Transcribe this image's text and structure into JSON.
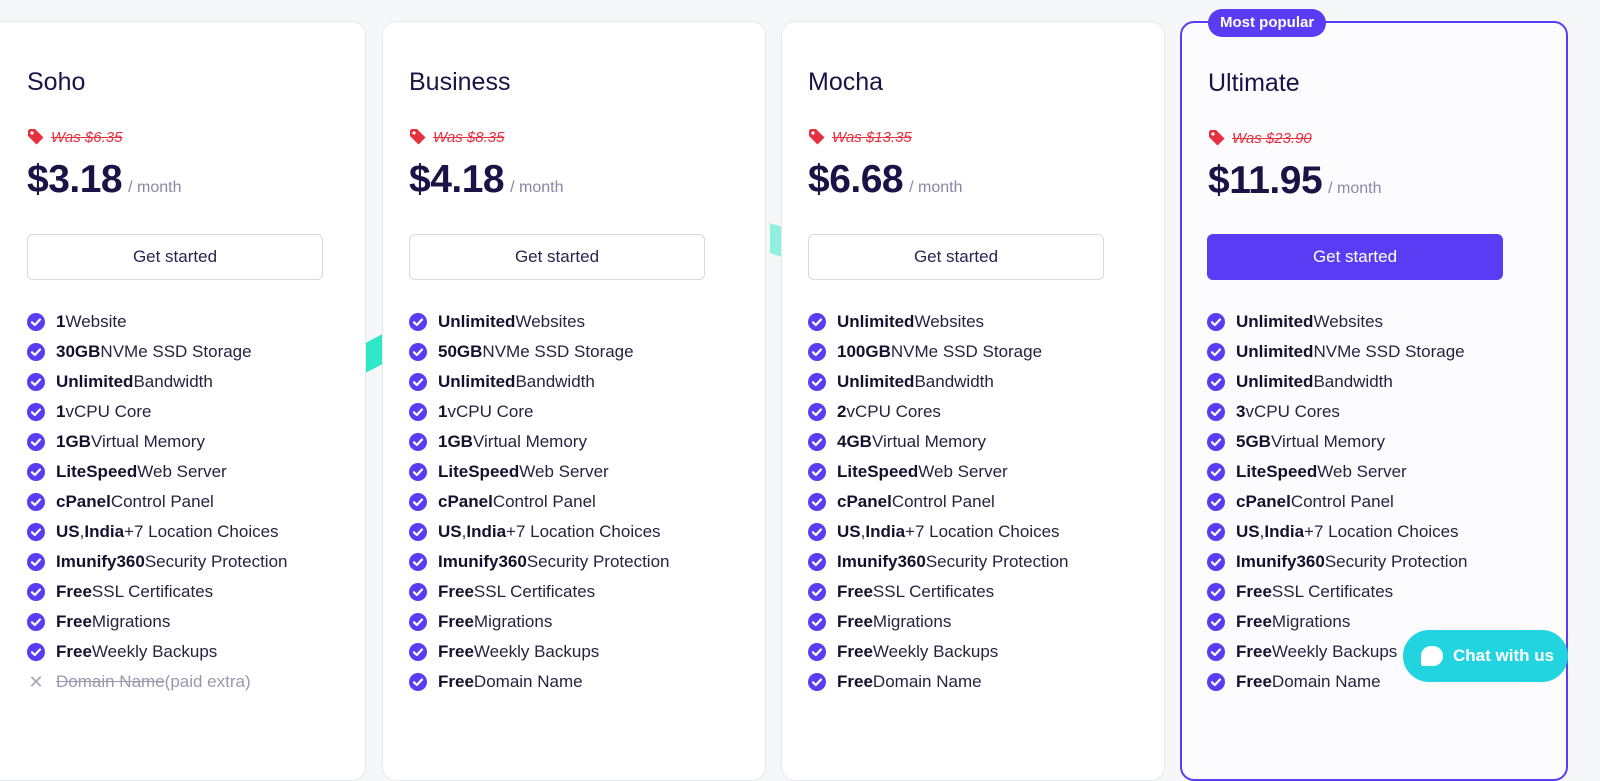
{
  "colors": {
    "accent": "#5b3cf5",
    "strike_red": "#e5303f",
    "chat": "#22d3e0",
    "navy": "#1a1446"
  },
  "plans": [
    {
      "name": "Soho",
      "was": "Was $6.35",
      "price": "$3.18",
      "period": "/ month",
      "cta": "Get started",
      "features": [
        {
          "bold": "1",
          "text": " Website"
        },
        {
          "bold": "30GB",
          "text": " NVMe SSD Storage"
        },
        {
          "bold": "Unlimited",
          "text": " Bandwidth"
        },
        {
          "bold": "1",
          "text": " vCPU Core"
        },
        {
          "bold": "1GB",
          "text": " Virtual Memory"
        },
        {
          "bold": "LiteSpeed",
          "text": " Web Server"
        },
        {
          "bold": "cPanel",
          "text": " Control Panel"
        },
        {
          "bold": "US",
          "text": ", ",
          "bold2": "India",
          "text2": " +7 Location Choices"
        },
        {
          "bold": "Imunify360",
          "text": " Security Protection"
        },
        {
          "bold": "Free",
          "text": " SSL Certificates"
        },
        {
          "bold": "Free",
          "text": " Migrations"
        },
        {
          "bold": "Free",
          "text": " Weekly Backups"
        },
        {
          "excluded": true,
          "strike": "Domain Name",
          "text": " (paid extra)"
        }
      ]
    },
    {
      "name": "Business",
      "was": "Was $8.35",
      "price": "$4.18",
      "period": "/ month",
      "cta": "Get started",
      "features": [
        {
          "bold": "Unlimited",
          "text": " Websites"
        },
        {
          "bold": "50GB",
          "text": " NVMe SSD Storage"
        },
        {
          "bold": "Unlimited",
          "text": " Bandwidth"
        },
        {
          "bold": "1",
          "text": " vCPU Core"
        },
        {
          "bold": "1GB",
          "text": " Virtual Memory"
        },
        {
          "bold": "LiteSpeed",
          "text": " Web Server"
        },
        {
          "bold": "cPanel",
          "text": " Control Panel"
        },
        {
          "bold": "US",
          "text": ", ",
          "bold2": "India",
          "text2": " +7 Location Choices"
        },
        {
          "bold": "Imunify360",
          "text": " Security Protection"
        },
        {
          "bold": "Free",
          "text": " SSL Certificates"
        },
        {
          "bold": "Free",
          "text": " Migrations"
        },
        {
          "bold": "Free",
          "text": " Weekly Backups"
        },
        {
          "bold": "Free",
          "text": " Domain Name"
        }
      ]
    },
    {
      "name": "Mocha",
      "was": "Was $13.35",
      "price": "$6.68",
      "period": "/ month",
      "cta": "Get started",
      "features": [
        {
          "bold": "Unlimited",
          "text": " Websites"
        },
        {
          "bold": "100GB",
          "text": " NVMe SSD Storage"
        },
        {
          "bold": "Unlimited",
          "text": " Bandwidth"
        },
        {
          "bold": "2",
          "text": " vCPU Cores"
        },
        {
          "bold": "4GB",
          "text": " Virtual Memory"
        },
        {
          "bold": "LiteSpeed",
          "text": " Web Server"
        },
        {
          "bold": "cPanel",
          "text": " Control Panel"
        },
        {
          "bold": "US",
          "text": ", ",
          "bold2": "India",
          "text2": " +7 Location Choices"
        },
        {
          "bold": "Imunify360",
          "text": " Security Protection"
        },
        {
          "bold": "Free",
          "text": " SSL Certificates"
        },
        {
          "bold": "Free",
          "text": " Migrations"
        },
        {
          "bold": "Free",
          "text": " Weekly Backups"
        },
        {
          "bold": "Free",
          "text": " Domain Name"
        }
      ]
    },
    {
      "name": "Ultimate",
      "badge": "Most popular",
      "was": "Was $23.90",
      "price": "$11.95",
      "period": "/ month",
      "cta": "Get started",
      "features": [
        {
          "bold": "Unlimited",
          "text": " Websites"
        },
        {
          "bold": "Unlimited",
          "text": " NVMe SSD Storage"
        },
        {
          "bold": "Unlimited",
          "text": " Bandwidth"
        },
        {
          "bold": "3",
          "text": " vCPU Cores"
        },
        {
          "bold": "5GB",
          "text": " Virtual Memory"
        },
        {
          "bold": "LiteSpeed",
          "text": " Web Server"
        },
        {
          "bold": "cPanel",
          "text": " Control Panel"
        },
        {
          "bold": "US",
          "text": ", ",
          "bold2": "India",
          "text2": " +7 Location Choices"
        },
        {
          "bold": "Imunify360",
          "text": " Security Protection"
        },
        {
          "bold": "Free",
          "text": " SSL Certificates"
        },
        {
          "bold": "Free",
          "text": " Migrations"
        },
        {
          "bold": "Free",
          "text": " Weekly Backups"
        },
        {
          "bold": "Free",
          "text": " Domain Name"
        }
      ]
    }
  ],
  "chat": {
    "label": "Chat with us",
    "icon": "chat-bubble-icon"
  }
}
